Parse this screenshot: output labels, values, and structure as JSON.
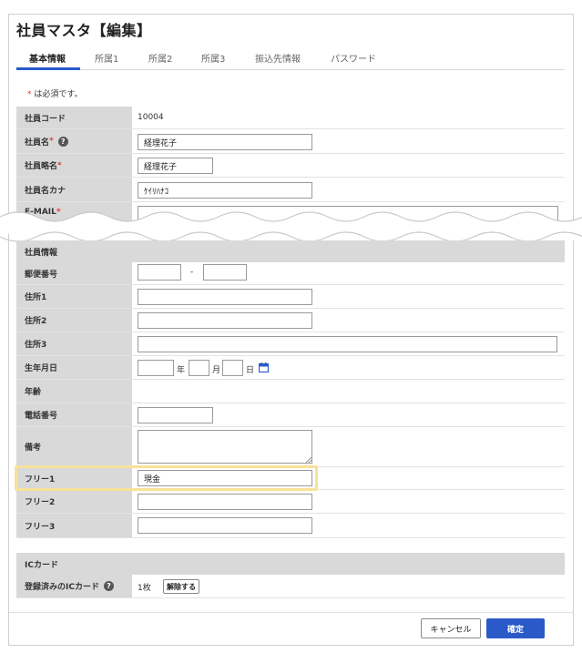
{
  "title": "社員マスタ【編集】",
  "tabs": [
    "基本情報",
    "所属1",
    "所属2",
    "所属3",
    "振込先情報",
    "パスワード"
  ],
  "required_note": "は必須です。",
  "required_mark": "*",
  "fields": {
    "emp_code": {
      "label": "社員コード",
      "value": "10004"
    },
    "emp_name": {
      "label": "社員名",
      "value": "経理花子"
    },
    "emp_short": {
      "label": "社員略名",
      "value": "経理花子"
    },
    "emp_kana": {
      "label": "社員名カナ",
      "value": "ｹｲﾘﾊﾅｺ"
    },
    "email": {
      "label": "E-MAIL",
      "value": ""
    }
  },
  "sections": {
    "employee_info": "社員情報",
    "ic_card": "ICカード"
  },
  "info": {
    "postal": {
      "label": "郵便番号",
      "sep": "-",
      "value1": "",
      "value2": ""
    },
    "address1": {
      "label": "住所1",
      "value": ""
    },
    "address2": {
      "label": "住所2",
      "value": ""
    },
    "address3": {
      "label": "住所3",
      "value": ""
    },
    "birthday": {
      "label": "生年月日",
      "year_unit": "年",
      "month_unit": "月",
      "day_unit": "日"
    },
    "age": {
      "label": "年齢",
      "value": ""
    },
    "phone": {
      "label": "電話番号",
      "value": ""
    },
    "notes": {
      "label": "備考",
      "value": ""
    },
    "free1": {
      "label": "フリー1",
      "value": "現金"
    },
    "free2": {
      "label": "フリー2",
      "value": ""
    },
    "free3": {
      "label": "フリー3",
      "value": ""
    }
  },
  "ic": {
    "label": "登録済みのICカード",
    "count": "1枚",
    "release_label": "解除する"
  },
  "buttons": {
    "cancel": "キャンセル",
    "ok": "確定"
  },
  "colors": {
    "accent": "#2a5ac8",
    "required": "#e23b3b",
    "highlight": "#f7e29a",
    "label_bg": "#d9d9d9"
  },
  "icons": {
    "help": "question-circle-icon",
    "calendar": "calendar-icon"
  }
}
